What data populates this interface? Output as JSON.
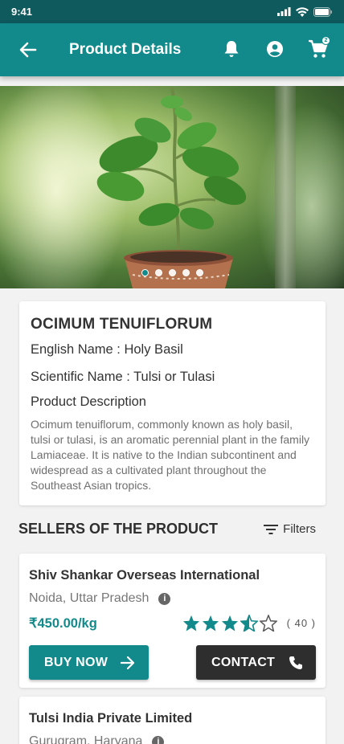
{
  "status": {
    "time": "9:41"
  },
  "header": {
    "title": "Product Details",
    "cart_count": "2"
  },
  "product": {
    "name": "OCIMUM TENUIFLORUM",
    "english_name": "English Name : Holy Basil",
    "scientific_name": "Scientific Name  : Tulsi or Tulasi",
    "description_title": "Product Description",
    "description": "Ocimum tenuiflorum, commonly known as holy basil, tulsi or tulasi, is an aromatic perennial plant in the family Lamiaceae. It is native to the Indian subcontinent and widespread as a cultivated plant throughout the Southeast Asian tropics."
  },
  "carousel": {
    "total": 5,
    "active": 1
  },
  "sellers": {
    "title": "SELLERS OF THE PRODUCT",
    "filters_label": "Filters",
    "items": [
      {
        "name": "Shiv Shankar Overseas International",
        "location": "Noida, Uttar Pradesh",
        "price": "₹450.00/kg",
        "rating": 3.5,
        "rating_count": "( 40 )",
        "buy_label": "BUY NOW",
        "contact_label": "CONTACT"
      },
      {
        "name": "Tulsi India Private Limited",
        "location": "Gurugram, Haryana"
      }
    ]
  },
  "colors": {
    "primary": "#128a8b",
    "status_bar": "#0e5a5d",
    "dark_button": "#2e2e2e"
  }
}
